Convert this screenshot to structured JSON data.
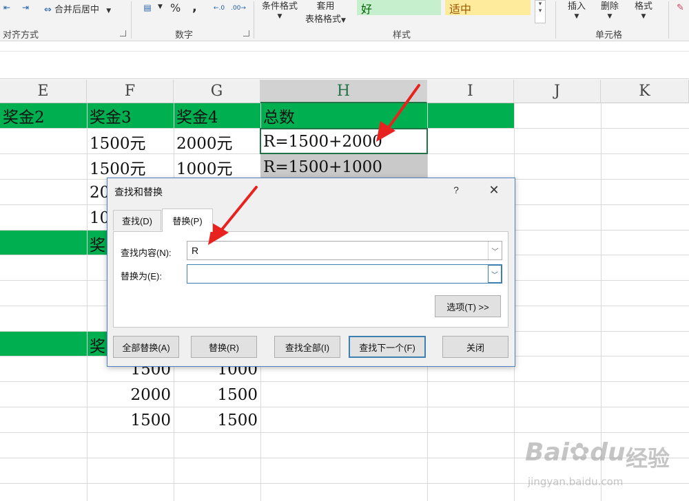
{
  "ribbon": {
    "merge_center": "合并后居中",
    "percent": "%",
    "comma": ",",
    "cond_format": "条件格式",
    "apply": "套用",
    "table_format": "表格格式",
    "style_good": "好",
    "style_neutral": "适中",
    "insert": "插入",
    "delete": "删除",
    "format": "格式",
    "group_alignment": "对齐方式",
    "group_number": "数字",
    "group_styles": "样式",
    "group_cells": "单元格"
  },
  "columns": [
    "E",
    "F",
    "G",
    "H",
    "I",
    "J",
    "K"
  ],
  "sheet": {
    "header_row": {
      "e": "奖金2",
      "f": "奖金3",
      "g": "奖金4",
      "h": "总数"
    },
    "row1": {
      "f": "1500元",
      "g": "2000元",
      "h": "R=1500+2000"
    },
    "row2": {
      "f": "1500元",
      "g": "1000元",
      "h": "R=1500+1000"
    },
    "row3": {
      "f_partial": "20"
    },
    "row4": {
      "f_partial": "10"
    },
    "green2_partial": "奖",
    "green3_partial": "奖",
    "row5": {
      "f": "1500",
      "g": "1000"
    },
    "row6": {
      "f": "2000",
      "g": "1500"
    },
    "row7": {
      "f": "1500",
      "g": "1500"
    }
  },
  "dialog": {
    "title": "查找和替换",
    "help": "?",
    "close_x": "✕",
    "tab_find": "查找(D)",
    "tab_replace": "替换(P)",
    "find_label": "查找内容(N):",
    "find_value": "R",
    "replace_label": "替换为(E):",
    "replace_value": "",
    "options_btn": "选项(T) >>",
    "replace_all_btn": "全部替换(A)",
    "replace_btn": "替换(R)",
    "find_all_btn": "查找全部(I)",
    "find_next_btn": "查找下一个(F)",
    "close_btn": "关闭"
  },
  "watermark": {
    "brand": "Bai",
    "brand2": "du",
    "cn": "经验",
    "url": "jingyan.baidu.com"
  },
  "colors": {
    "green_fill": "#00b050",
    "annotation_red": "#e8231f",
    "excel_green": "#217346"
  }
}
